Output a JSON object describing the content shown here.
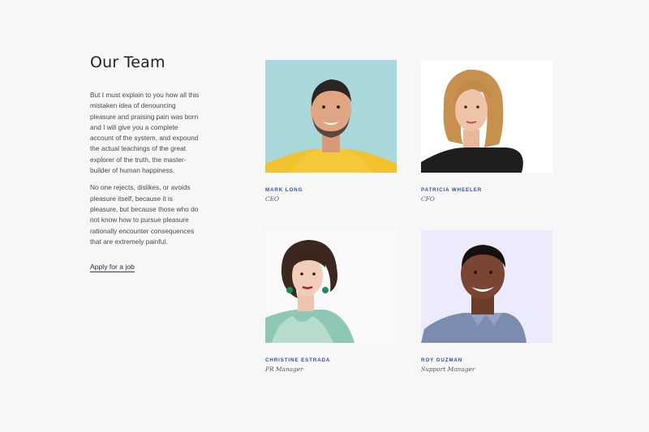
{
  "intro": {
    "title": "Our Team",
    "paragraphs": [
      "But I must explain to you how all this mistaken idea of denouncing pleasure and praising pain was born and I will give you a complete account of the system, and expound the actual teachings of the great explorer of the truth, the master-builder of human happiness.",
      "No one rejects, dislikes, or avoids pleasure itself, because it is pleasure, but because those who do not know how to pursue pleasure rationally encounter consequences that are extremely painful."
    ],
    "apply_link": "Apply for a job"
  },
  "members": [
    {
      "name": "MARK LONG",
      "role": "CEO",
      "photo_bg": "#a9d8da",
      "icon": "portrait-photo"
    },
    {
      "name": "PATRICIA WHEELER",
      "role": "CFO",
      "photo_bg": "#ffffff",
      "icon": "portrait-photo"
    },
    {
      "name": "CHRISTINE ESTRADA",
      "role": "PR Manager",
      "photo_bg": "#fbf9f9",
      "icon": "portrait-photo"
    },
    {
      "name": "ROY GUZMAN",
      "role": "Support Manager",
      "photo_bg": "#ecebfb",
      "icon": "portrait-photo"
    }
  ],
  "colors": {
    "accent": "#2b4fb8",
    "background": "#f7f7f7"
  }
}
